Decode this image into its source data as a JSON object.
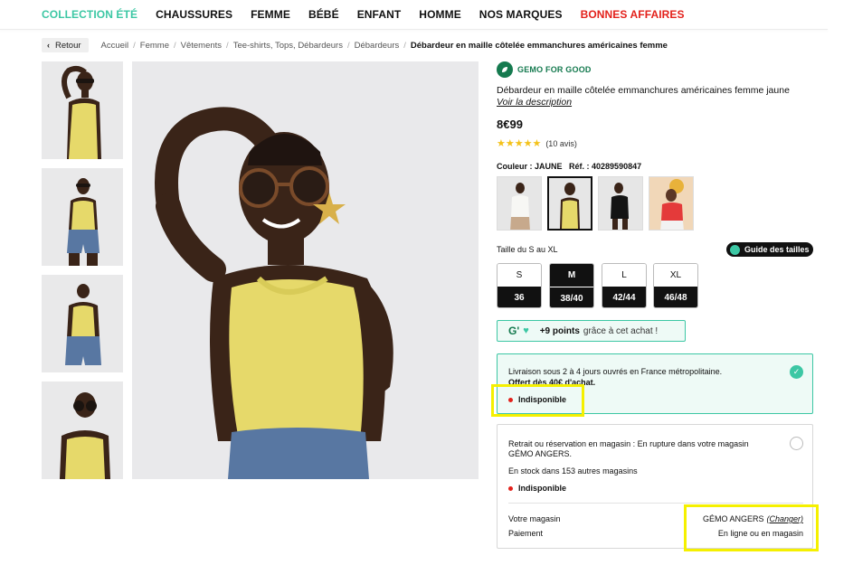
{
  "nav": {
    "items": [
      {
        "label": "COLLECTION ÉTÉ",
        "style": "accent"
      },
      {
        "label": "CHAUSSURES",
        "style": "normal"
      },
      {
        "label": "FEMME",
        "style": "normal"
      },
      {
        "label": "BÉBÉ",
        "style": "normal"
      },
      {
        "label": "ENFANT",
        "style": "normal"
      },
      {
        "label": "HOMME",
        "style": "normal"
      },
      {
        "label": "NOS MARQUES",
        "style": "normal"
      },
      {
        "label": "BONNES AFFAIRES",
        "style": "red"
      }
    ]
  },
  "breadcrumb": {
    "back_label": "Retour",
    "items": [
      "Accueil",
      "Femme",
      "Vêtements",
      "Tee-shirts, Tops, Débardeurs",
      "Débardeurs",
      "Débardeur en maille côtelée emmanchures américaines femme"
    ]
  },
  "product": {
    "brand_label": "GEMO FOR GOOD",
    "title": "Débardeur en maille côtelée emmanchures américaines femme jaune",
    "description_link": "Voir la description",
    "price": "8€99",
    "stars": "★★★★★",
    "reviews": "(10 avis)",
    "rating_value": 5,
    "color_label": "Couleur : JAUNE",
    "ref_label": "Réf. : 40289590847",
    "swatches": [
      "blanc",
      "jaune",
      "noir",
      "rouge"
    ],
    "selected_swatch": 1
  },
  "sizes": {
    "label": "Taille du S au XL",
    "guide_label": "Guide des tailles",
    "items": [
      {
        "letter": "S",
        "eu": "36",
        "selected": false
      },
      {
        "letter": "M",
        "eu": "38/40",
        "selected": true
      },
      {
        "letter": "L",
        "eu": "42/44",
        "selected": false
      },
      {
        "letter": "XL",
        "eu": "46/48",
        "selected": false
      }
    ]
  },
  "loyalty": {
    "logo": "G'",
    "points_bold": "+9 points",
    "points_rest": "grâce à cet achat !"
  },
  "shipping": {
    "line1": "Livraison sous 2 à 4 jours ouvrés en France métropolitaine.",
    "line2": "Offert dès 40€ d'achat.",
    "status": "Indisponible"
  },
  "store": {
    "line1": "Retrait ou réservation en magasin : En rupture dans votre magasin",
    "line2": "GÉMO ANGERS.",
    "stock": "En stock dans 153 autres magasins",
    "status": "Indisponible",
    "my_store_key": "Votre magasin",
    "my_store_value": "GÉMO ANGERS",
    "change_label": "(Changer)",
    "payment_key": "Paiement",
    "payment_value": "En ligne ou en magasin"
  },
  "colors": {
    "accent": "#3cc7a4",
    "brand_green": "#157a4f",
    "sale_red": "#e3211b",
    "highlight": "#f5f000",
    "shirt_yellow": "#e6d96a"
  }
}
